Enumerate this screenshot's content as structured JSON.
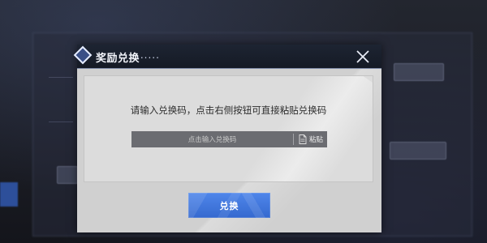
{
  "dialog": {
    "title": "奖励兑换",
    "title_suffix": "......",
    "instruction": "请输入兑换码，点击右侧按钮可直接粘贴兑换码",
    "code_input": {
      "placeholder": "点击输入兑换码",
      "value": ""
    },
    "paste_label": "粘贴",
    "confirm_label": "兑换"
  },
  "colors": {
    "header_bg": "#1d2432",
    "body_bg": "#d0d0d0",
    "input_bg": "#6b6c71",
    "confirm_bg": "#4479e0"
  },
  "icons": {
    "close": "close-icon",
    "paste": "document-icon",
    "title_badge": "diamond-icon"
  }
}
